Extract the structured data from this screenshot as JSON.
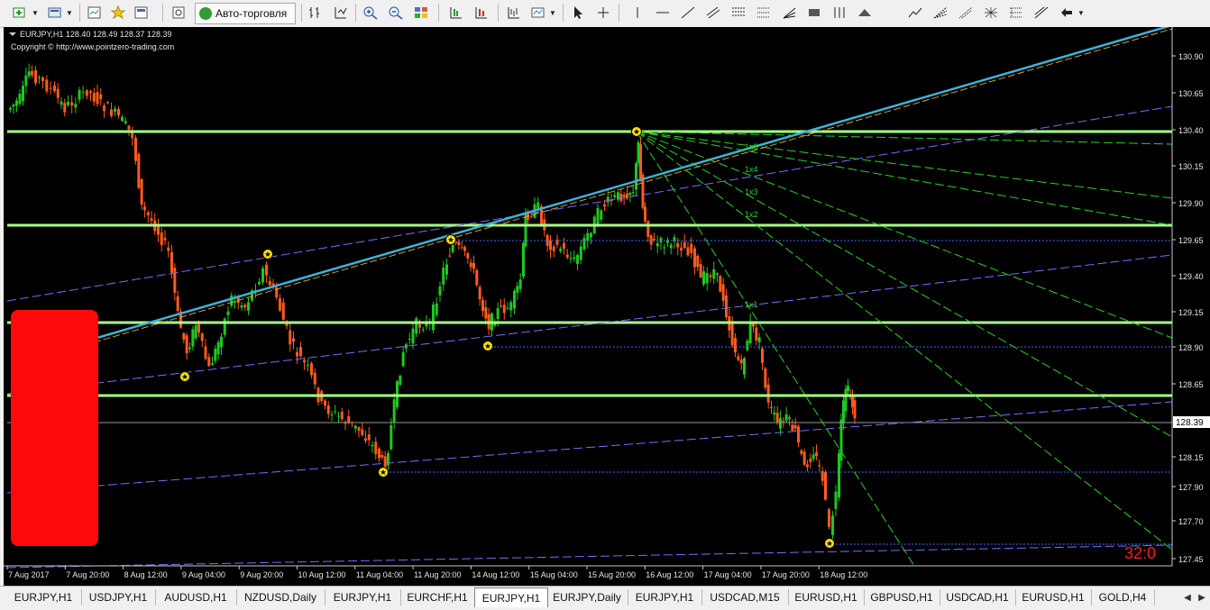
{
  "toolbar": {
    "icons": [
      "new-chart-icon",
      "profiles-icon",
      "market-watch-icon",
      "data-window-icon",
      "navigator-icon",
      "terminal-icon",
      "strategy-tester-icon",
      "bar-chart-icon",
      "candlestick-icon",
      "line-chart-icon",
      "zoom-in-icon",
      "zoom-out-icon",
      "tile-windows-icon",
      "chart-shift-icon",
      "auto-scroll-icon",
      "periods-icon",
      "templates-icon",
      "cursor-icon",
      "crosshair-icon",
      "vertical-line-icon",
      "horizontal-line-icon",
      "trendline-icon",
      "equidistant-channel-icon",
      "fibo-retracement-icon",
      "fibo-expansion-icon",
      "gann-fan-icon",
      "rectangle-icon",
      "triangle-icon",
      "arrow-icon",
      "text-icon",
      "label-icon",
      "fibo-fan-icon",
      "cycle-lines-icon",
      "andrews-pitchfork-icon",
      "more-tools-icon"
    ],
    "autotrade_label": "Авто-торговля"
  },
  "chart": {
    "header_line": "EURJPY,H1  128.40 128.49 128.37 128.39",
    "copyright": "Copyright © http://www.pointzero-trading.com",
    "current_price_label": "128.39",
    "counter_text": "32:0",
    "gann_labels": [
      "1x8",
      "1x4",
      "1x3",
      "1x2",
      "1x1"
    ],
    "price_ticks": [
      "130.90",
      "130.65",
      "130.40",
      "130.15",
      "129.90",
      "129.65",
      "129.40",
      "129.15",
      "128.90",
      "128.65",
      "128.39",
      "128.15",
      "127.90",
      "127.70",
      "127.45"
    ],
    "time_ticks": [
      "7 Aug 2017",
      "7 Aug 20:00",
      "8 Aug 12:00",
      "9 Aug 04:00",
      "9 Aug 20:00",
      "10 Aug 12:00",
      "11 Aug 04:00",
      "11 Aug 20:00",
      "14 Aug 12:00",
      "15 Aug 04:00",
      "15 Aug 20:00",
      "16 Aug 12:00",
      "17 Aug 04:00",
      "17 Aug 20:00",
      "18 Aug 12:00"
    ],
    "colors": {
      "background": "#000000",
      "bull": "#1ec81e",
      "bear": "#ff5a1e",
      "support": "#a8ff88",
      "channel": "#7b6cff",
      "trend": "#3fb0d8",
      "gann": "#29d229",
      "dotted": "#3a6cff",
      "marker": "#ffe000",
      "counter": "#ff1a1a"
    }
  },
  "tabs": [
    {
      "label": "EURJPY,H1",
      "active": false
    },
    {
      "label": "USDJPY,H1",
      "active": false
    },
    {
      "label": "AUDUSD,H1",
      "active": false
    },
    {
      "label": "NZDUSD,Daily",
      "active": false
    },
    {
      "label": "EURJPY,H1",
      "active": false
    },
    {
      "label": "EURCHF,H1",
      "active": false
    },
    {
      "label": "EURJPY,H1",
      "active": true
    },
    {
      "label": "EURJPY,Daily",
      "active": false
    },
    {
      "label": "EURJPY,H1",
      "active": false
    },
    {
      "label": "USDCAD,M15",
      "active": false
    },
    {
      "label": "EURUSD,H1",
      "active": false
    },
    {
      "label": "GBPUSD,H1",
      "active": false
    },
    {
      "label": "USDCAD,H1",
      "active": false
    },
    {
      "label": "EURUSD,H1",
      "active": false
    },
    {
      "label": "GOLD,H4",
      "active": false
    }
  ]
}
